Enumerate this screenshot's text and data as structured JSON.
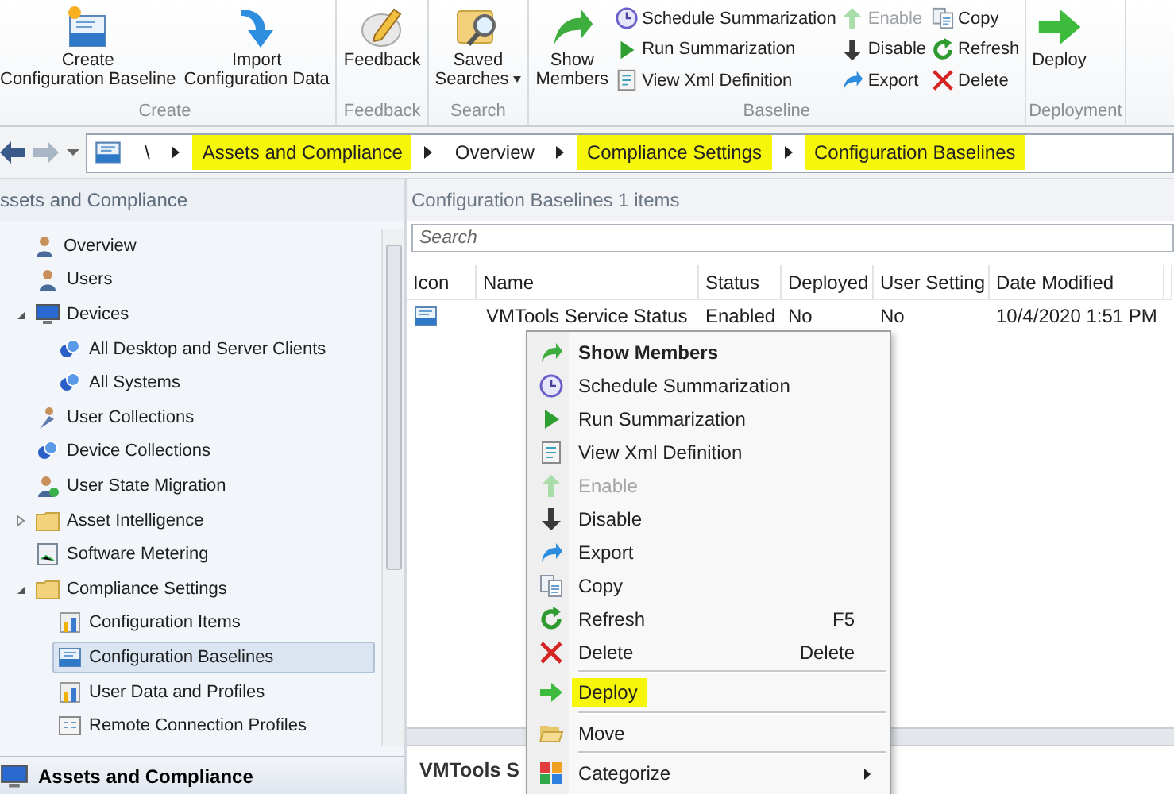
{
  "ribbon": {
    "groups": [
      {
        "label": "Create",
        "large": [
          {
            "lines": [
              "Create",
              "Configuration Baseline"
            ],
            "dropdown": false
          },
          {
            "lines": [
              "Import",
              "Configuration Data"
            ],
            "dropdown": false
          }
        ]
      },
      {
        "label": "Feedback",
        "large": [
          {
            "lines": [
              "Feedback"
            ],
            "dropdown": false
          }
        ]
      },
      {
        "label": "Search",
        "large": [
          {
            "lines": [
              "Saved",
              "Searches"
            ],
            "dropdown": true
          }
        ]
      },
      {
        "label": "Baseline",
        "large": [
          {
            "lines": [
              "Show",
              "Members"
            ],
            "dropdown": false
          }
        ],
        "small_columns": [
          [
            {
              "label": "Schedule Summarization",
              "disabled": false
            },
            {
              "label": "Run Summarization",
              "disabled": false
            },
            {
              "label": "View Xml Definition",
              "disabled": false
            }
          ],
          [
            {
              "label": "Enable",
              "disabled": true
            },
            {
              "label": "Disable",
              "disabled": false
            },
            {
              "label": "Export",
              "disabled": false
            }
          ],
          [
            {
              "label": "Copy",
              "disabled": false
            },
            {
              "label": "Refresh",
              "disabled": false
            },
            {
              "label": "Delete",
              "disabled": false
            }
          ]
        ]
      },
      {
        "label": "Deployment",
        "large": [
          {
            "lines": [
              "Deploy"
            ],
            "dropdown": false
          }
        ]
      }
    ]
  },
  "address_bar": {
    "root": "\\",
    "crumbs": [
      {
        "label": "Assets and Compliance",
        "highlighted": true
      },
      {
        "label": "Overview",
        "highlighted": false
      },
      {
        "label": "Compliance Settings",
        "highlighted": true
      },
      {
        "label": "Configuration Baselines",
        "highlighted": true
      }
    ]
  },
  "navigation": {
    "title": "ssets and Compliance",
    "tree": [
      {
        "label": "Overview",
        "selected": false,
        "children": [
          {
            "label": "Users",
            "selected": false
          },
          {
            "label": "Devices",
            "selected": false,
            "expanded": true,
            "children": [
              {
                "label": "All Desktop and Server Clients",
                "selected": false
              },
              {
                "label": "All Systems",
                "selected": false
              }
            ]
          },
          {
            "label": "User Collections",
            "selected": false
          },
          {
            "label": "Device Collections",
            "selected": false
          },
          {
            "label": "User State Migration",
            "selected": false
          },
          {
            "label": "Asset Intelligence",
            "selected": false,
            "expanded": false
          },
          {
            "label": "Software Metering",
            "selected": false
          },
          {
            "label": "Compliance Settings",
            "selected": false,
            "expanded": true,
            "children": [
              {
                "label": "Configuration Items",
                "selected": false
              },
              {
                "label": "Configuration Baselines",
                "selected": true
              },
              {
                "label": "User Data and Profiles",
                "selected": false
              },
              {
                "label": "Remote Connection Profiles",
                "selected": false
              }
            ]
          }
        ]
      }
    ],
    "workspace": "Assets and Compliance"
  },
  "list": {
    "title": "Configuration Baselines 1 items",
    "search": {
      "placeholder": "Search"
    },
    "columns": [
      "Icon",
      "Name",
      "Status",
      "Deployed",
      "User Setting",
      "Date Modified"
    ],
    "rows": [
      {
        "name": "VMTools Service Status",
        "status": "Enabled",
        "deployed": "No",
        "user_setting": "No",
        "date_modified": "10/4/2020 1:51 PM"
      }
    ],
    "detail_title": "VMTools S"
  },
  "context_menu": [
    {
      "kind": "item",
      "label": "Show Members",
      "bold": true,
      "disabled": false,
      "highlighted": false
    },
    {
      "kind": "item",
      "label": "Schedule Summarization",
      "bold": false,
      "disabled": false,
      "highlighted": false
    },
    {
      "kind": "item",
      "label": "Run Summarization",
      "bold": false,
      "disabled": false,
      "highlighted": false
    },
    {
      "kind": "item",
      "label": "View Xml Definition",
      "bold": false,
      "disabled": false,
      "highlighted": false
    },
    {
      "kind": "item",
      "label": "Enable",
      "bold": false,
      "disabled": true,
      "highlighted": false
    },
    {
      "kind": "item",
      "label": "Disable",
      "bold": false,
      "disabled": false,
      "highlighted": false
    },
    {
      "kind": "item",
      "label": "Export",
      "bold": false,
      "disabled": false,
      "highlighted": false
    },
    {
      "kind": "item",
      "label": "Copy",
      "bold": false,
      "disabled": false,
      "highlighted": false
    },
    {
      "kind": "item",
      "label": "Refresh",
      "shortcut": "F5",
      "bold": false,
      "disabled": false,
      "highlighted": false
    },
    {
      "kind": "item",
      "label": "Delete",
      "shortcut": "Delete",
      "bold": false,
      "disabled": false,
      "highlighted": false
    },
    {
      "kind": "separator"
    },
    {
      "kind": "item",
      "label": "Deploy",
      "bold": false,
      "disabled": false,
      "highlighted": true
    },
    {
      "kind": "separator"
    },
    {
      "kind": "item",
      "label": "Move",
      "bold": false,
      "disabled": false,
      "highlighted": false
    },
    {
      "kind": "separator"
    },
    {
      "kind": "item",
      "label": "Categorize",
      "submenu": true,
      "bold": false,
      "disabled": false,
      "highlighted": false
    }
  ]
}
